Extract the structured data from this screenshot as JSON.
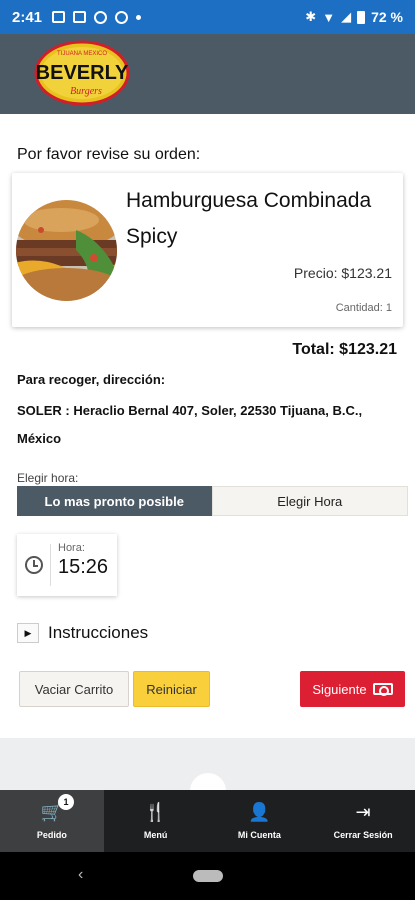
{
  "status_bar": {
    "time": "2:41",
    "battery": "72 %"
  },
  "brand": {
    "logo_top": "TIJUANA MEXICO",
    "logo_main": "BEVERLY",
    "logo_sub": "Burgers"
  },
  "order": {
    "review_title": "Por favor revise su orden:",
    "item": {
      "name": "Hamburguesa Combinada Spicy",
      "price": "Precio: $123.21",
      "quantity": "Cantidad: 1"
    },
    "total": "Total: $123.21"
  },
  "pickup": {
    "label": "Para recoger, dirección:",
    "address": "SOLER : Heraclio Bernal 407, Soler, 22530 Tijuana, B.C., México"
  },
  "time_choice": {
    "label": "Elegir hora:",
    "options": [
      "Lo mas pronto posible",
      "Elegir Hora"
    ],
    "selected": "Lo mas pronto posible",
    "time_caption": "Hora:",
    "time_value": "15:26"
  },
  "instructions": {
    "label": "Instrucciones"
  },
  "buttons": {
    "empty_cart": "Vaciar Carrito",
    "reset": "Reiniciar",
    "next": "Siguiente"
  },
  "tabs": [
    {
      "label": "Pedido",
      "icon": "cart-icon",
      "badge": "1",
      "active": true
    },
    {
      "label": "Menú",
      "icon": "utensils-icon",
      "active": false
    },
    {
      "label": "Mi Cuenta",
      "icon": "user-icon",
      "active": false
    },
    {
      "label": "Cerrar Sesión",
      "icon": "logout-icon",
      "active": false
    }
  ],
  "colors": {
    "primary": "#4c5a66",
    "status_bar": "#1c6fc2",
    "next_button": "#dc1f32",
    "reset_button": "#f9cf3c"
  }
}
